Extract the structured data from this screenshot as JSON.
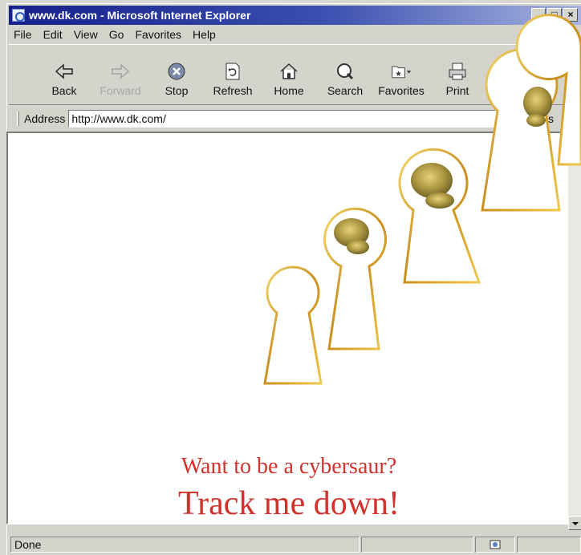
{
  "window": {
    "title": "www.dk.com - Microsoft Internet Explorer",
    "controls": [
      "_",
      "□",
      "×"
    ]
  },
  "menu": [
    "File",
    "Edit",
    "View",
    "Go",
    "Favorites",
    "Help"
  ],
  "toolbar": [
    {
      "label": "Back",
      "icon": "back-arrow-icon",
      "enabled": true
    },
    {
      "label": "Forward",
      "icon": "forward-arrow-icon",
      "enabled": false
    },
    {
      "label": "Stop",
      "icon": "stop-icon",
      "enabled": true
    },
    {
      "label": "Refresh",
      "icon": "refresh-icon",
      "enabled": true
    },
    {
      "label": "Home",
      "icon": "home-icon",
      "enabled": true
    },
    {
      "label": "Search",
      "icon": "search-icon",
      "enabled": true
    },
    {
      "label": "Favorites",
      "icon": "favorites-folder-icon",
      "enabled": true
    },
    {
      "label": "Print",
      "icon": "printer-icon",
      "enabled": true
    }
  ],
  "address": {
    "label": "Address",
    "value": "http://www.dk.com/",
    "links_label": "Links"
  },
  "page": {
    "tagline": "Want to be a cybersaur?",
    "headline": "Track me down!",
    "accent_color": "#d2322c",
    "keyhole_color": "#e0b12c"
  },
  "status": {
    "text": "Done"
  }
}
